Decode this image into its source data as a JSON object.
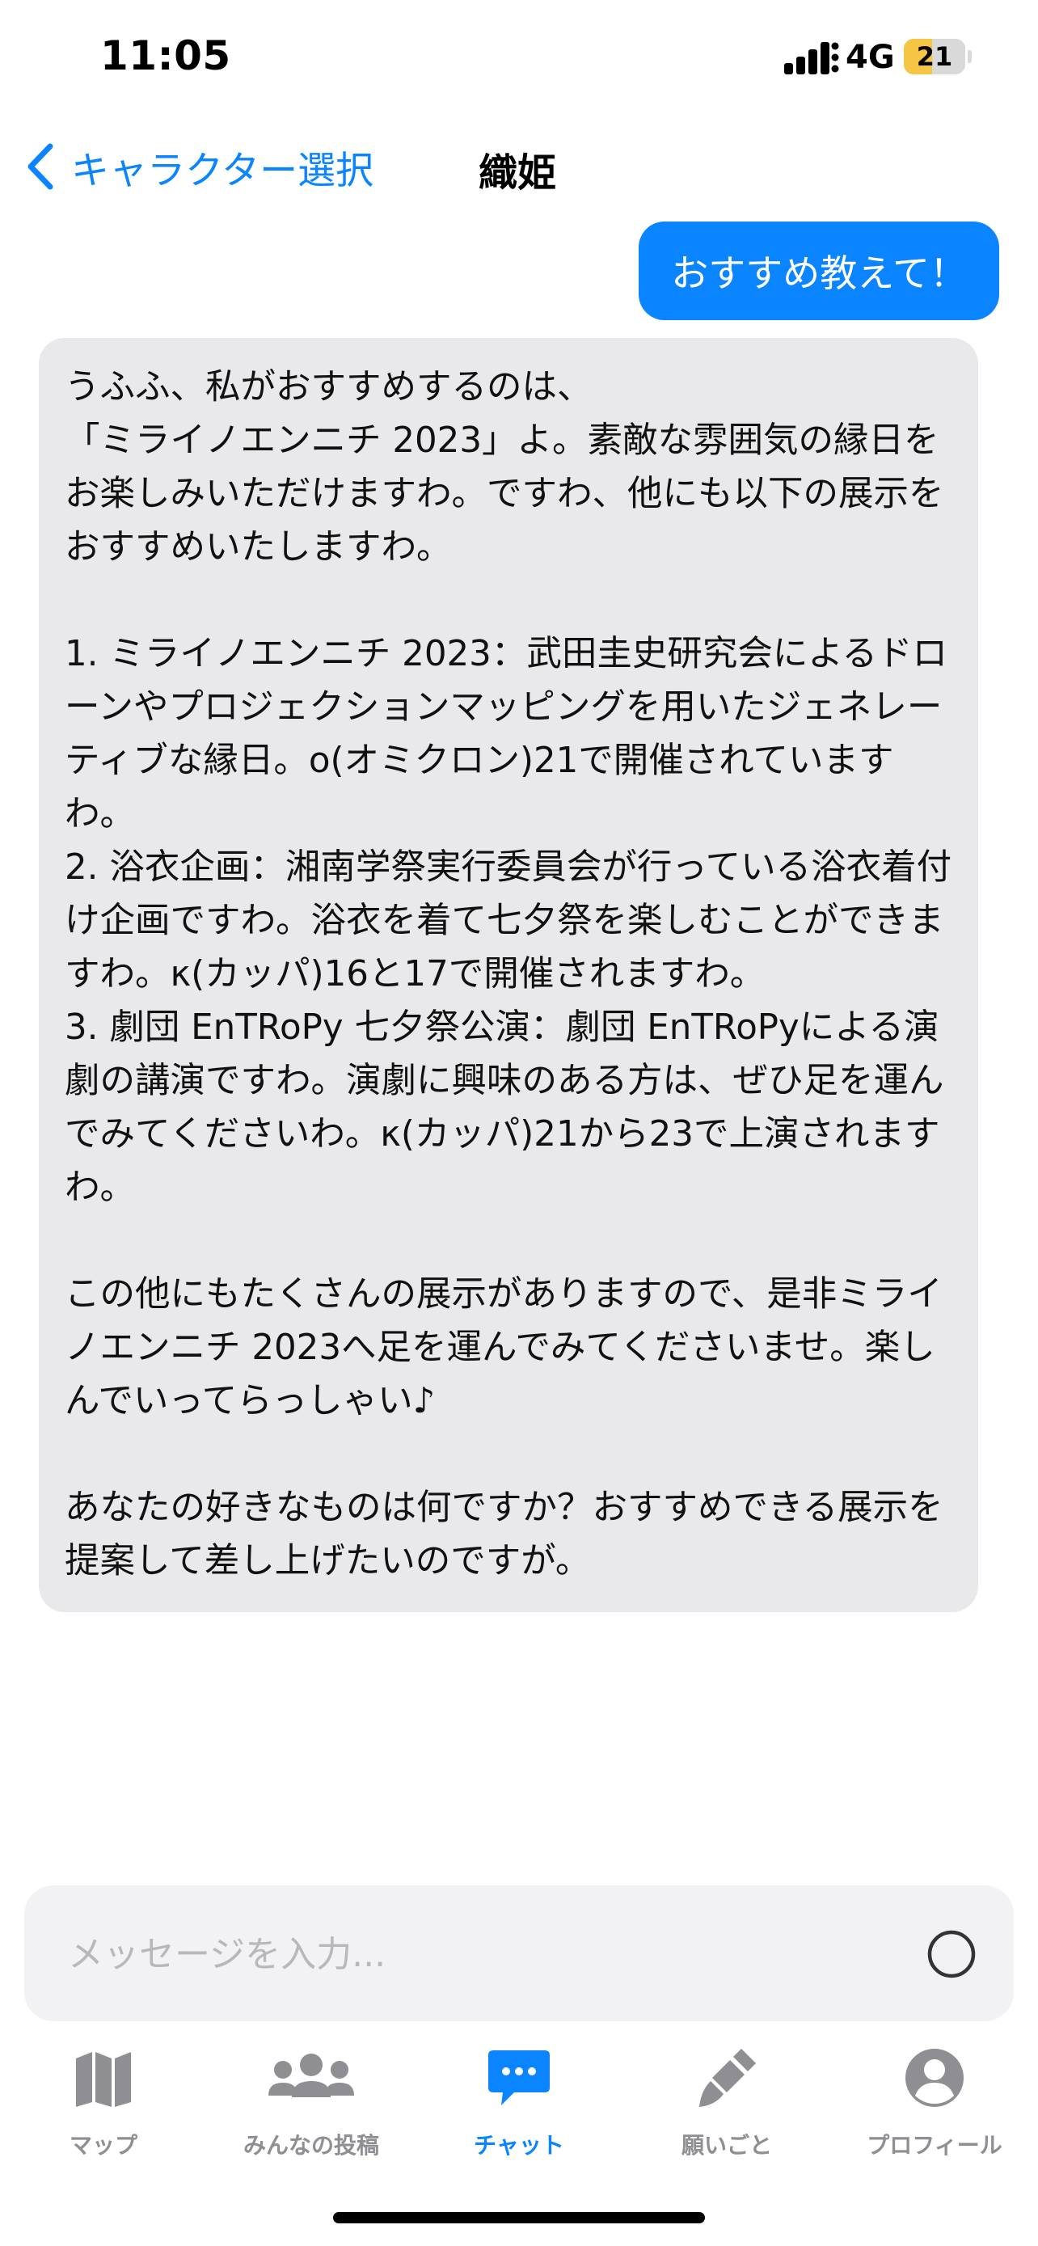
{
  "status_bar": {
    "time": "11:05",
    "network": "4G",
    "battery_level": "21",
    "battery_fraction": 0.21
  },
  "nav": {
    "back_label": "キャラクター選択",
    "title": "織姫"
  },
  "messages": [
    {
      "role": "user",
      "text": "おすすめ教えて！"
    },
    {
      "role": "assistant",
      "text": "うふふ、私がおすすめするのは、\n「ミライノエンニチ 2023」よ。素敵な雰囲気の縁日をお楽しみいただけますわ。ですわ、他にも以下の展示をおすすめいたしますわ。\n\n1. ミライノエンニチ 2023：武田圭史研究会によるドローンやプロジェクションマッピングを用いたジェネレーティブな縁日。o(オミクロン)21で開催されていますわ。\n2. 浴衣企画：湘南学祭実行委員会が行っている浴衣着付け企画ですわ。浴衣を着て七夕祭を楽しむことができますわ。κ(カッパ)16と17で開催されますわ。\n3. 劇団 EnTRoPy 七夕祭公演：劇団 EnTRoPyによる演劇の講演ですわ。演劇に興味のある方は、ぜひ足を運んでみてくださいわ。κ(カッパ)21から23で上演されますわ。\n\nこの他にもたくさんの展示がありますので、是非ミライノエンニチ 2023へ足を運んでみてくださいませ。楽しんでいってらっしゃい♪\n\nあなたの好きなものは何ですか？おすすめできる展示を提案して差し上げたいのですが。"
    }
  ],
  "input": {
    "placeholder": "メッセージを入力..."
  },
  "tabs": [
    {
      "label": "マップ",
      "icon": "map-icon",
      "active": false
    },
    {
      "label": "みんなの投稿",
      "icon": "people-icon",
      "active": false
    },
    {
      "label": "チャット",
      "icon": "chat-bubble-icon",
      "active": true
    },
    {
      "label": "願いごと",
      "icon": "brush-icon",
      "active": false
    },
    {
      "label": "プロフィール",
      "icon": "profile-icon",
      "active": false
    }
  ],
  "colors": {
    "accent": "#0a84ff",
    "bot_bubble": "#e9e9eb",
    "inactive_tab": "#8e8e93",
    "battery": "#f6c544"
  }
}
